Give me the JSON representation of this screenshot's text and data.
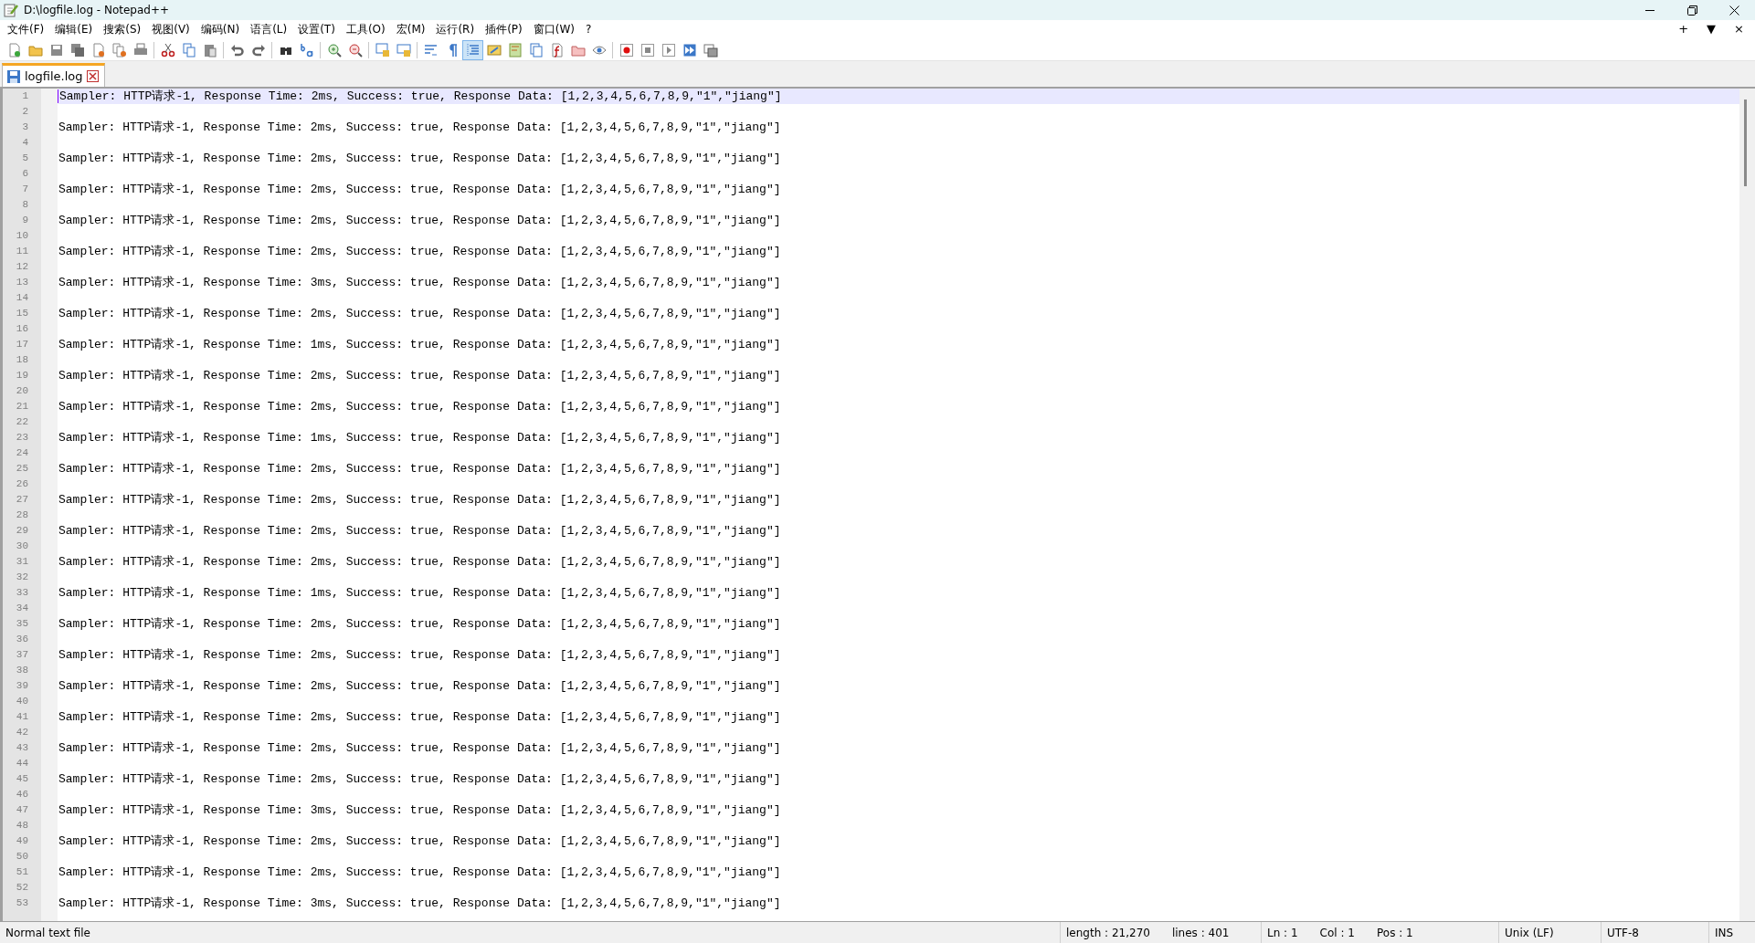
{
  "window": {
    "title": "D:\\logfile.log - Notepad++"
  },
  "menu": [
    "文件(F)",
    "编辑(E)",
    "搜索(S)",
    "视图(V)",
    "编码(N)",
    "语言(L)",
    "设置(T)",
    "工具(O)",
    "宏(M)",
    "运行(R)",
    "插件(P)",
    "窗口(W)",
    "?"
  ],
  "toolbar": [
    [
      {
        "kind": "new",
        "pressed": false
      },
      {
        "kind": "open",
        "pressed": false
      },
      {
        "kind": "save",
        "pressed": false
      },
      {
        "kind": "save_all",
        "pressed": false
      },
      {
        "kind": "close",
        "pressed": false
      },
      {
        "kind": "close_all",
        "pressed": false
      },
      {
        "kind": "print",
        "pressed": false
      }
    ],
    [
      {
        "kind": "cut",
        "pressed": false
      },
      {
        "kind": "copy",
        "pressed": false
      },
      {
        "kind": "paste",
        "pressed": false
      }
    ],
    [
      {
        "kind": "undo",
        "pressed": false
      },
      {
        "kind": "redo",
        "pressed": false
      }
    ],
    [
      {
        "kind": "find",
        "pressed": false
      },
      {
        "kind": "replace",
        "pressed": false
      }
    ],
    [
      {
        "kind": "zoom_in",
        "pressed": false
      },
      {
        "kind": "zoom_out",
        "pressed": false
      }
    ],
    [
      {
        "kind": "sync_v",
        "pressed": false
      },
      {
        "kind": "sync_h",
        "pressed": false
      }
    ],
    [
      {
        "kind": "wrap",
        "pressed": false
      },
      {
        "kind": "all_chars",
        "pressed": false
      },
      {
        "kind": "indent_guide",
        "pressed": true
      },
      {
        "kind": "udl",
        "pressed": false
      },
      {
        "kind": "doc_map",
        "pressed": false
      },
      {
        "kind": "doc_list",
        "pressed": false
      },
      {
        "kind": "function_list",
        "pressed": false
      },
      {
        "kind": "folder",
        "pressed": false
      },
      {
        "kind": "monitor",
        "pressed": false
      }
    ],
    [
      {
        "kind": "record",
        "pressed": false
      },
      {
        "kind": "stop",
        "pressed": false
      },
      {
        "kind": "play",
        "pressed": false
      },
      {
        "kind": "play_multi",
        "pressed": false
      },
      {
        "kind": "save_macro",
        "pressed": false
      }
    ]
  ],
  "tabs": [
    {
      "label": "logfile.log",
      "selected": true
    }
  ],
  "tab_bar_controls": [
    "+",
    "▼",
    "×"
  ],
  "editor": {
    "lines": [
      {
        "number": "1",
        "text": "Sampler: HTTP请求-1, Response Time: 2ms, Success: true, Response Data: [1,2,3,4,5,6,7,8,9,\"1\",\"jiang\"]",
        "current": true
      },
      {
        "number": "2",
        "current": false
      },
      {
        "number": "3",
        "text": "Sampler: HTTP请求-1, Response Time: 2ms, Success: true, Response Data: [1,2,3,4,5,6,7,8,9,\"1\",\"jiang\"]",
        "current": false
      },
      {
        "number": "4",
        "current": false
      },
      {
        "number": "5",
        "text": "Sampler: HTTP请求-1, Response Time: 2ms, Success: true, Response Data: [1,2,3,4,5,6,7,8,9,\"1\",\"jiang\"]",
        "current": false
      },
      {
        "number": "6",
        "current": false
      },
      {
        "number": "7",
        "text": "Sampler: HTTP请求-1, Response Time: 2ms, Success: true, Response Data: [1,2,3,4,5,6,7,8,9,\"1\",\"jiang\"]",
        "current": false
      },
      {
        "number": "8",
        "current": false
      },
      {
        "number": "9",
        "text": "Sampler: HTTP请求-1, Response Time: 2ms, Success: true, Response Data: [1,2,3,4,5,6,7,8,9,\"1\",\"jiang\"]",
        "current": false
      },
      {
        "number": "10",
        "current": false
      },
      {
        "number": "11",
        "text": "Sampler: HTTP请求-1, Response Time: 2ms, Success: true, Response Data: [1,2,3,4,5,6,7,8,9,\"1\",\"jiang\"]",
        "current": false
      },
      {
        "number": "12",
        "current": false
      },
      {
        "number": "13",
        "text": "Sampler: HTTP请求-1, Response Time: 3ms, Success: true, Response Data: [1,2,3,4,5,6,7,8,9,\"1\",\"jiang\"]",
        "current": false
      },
      {
        "number": "14",
        "current": false
      },
      {
        "number": "15",
        "text": "Sampler: HTTP请求-1, Response Time: 2ms, Success: true, Response Data: [1,2,3,4,5,6,7,8,9,\"1\",\"jiang\"]",
        "current": false
      },
      {
        "number": "16",
        "current": false
      },
      {
        "number": "17",
        "text": "Sampler: HTTP请求-1, Response Time: 1ms, Success: true, Response Data: [1,2,3,4,5,6,7,8,9,\"1\",\"jiang\"]",
        "current": false
      },
      {
        "number": "18",
        "current": false
      },
      {
        "number": "19",
        "text": "Sampler: HTTP请求-1, Response Time: 2ms, Success: true, Response Data: [1,2,3,4,5,6,7,8,9,\"1\",\"jiang\"]",
        "current": false
      },
      {
        "number": "20",
        "current": false
      },
      {
        "number": "21",
        "text": "Sampler: HTTP请求-1, Response Time: 2ms, Success: true, Response Data: [1,2,3,4,5,6,7,8,9,\"1\",\"jiang\"]",
        "current": false
      },
      {
        "number": "22",
        "current": false
      },
      {
        "number": "23",
        "text": "Sampler: HTTP请求-1, Response Time: 1ms, Success: true, Response Data: [1,2,3,4,5,6,7,8,9,\"1\",\"jiang\"]",
        "current": false
      },
      {
        "number": "24",
        "current": false
      },
      {
        "number": "25",
        "text": "Sampler: HTTP请求-1, Response Time: 2ms, Success: true, Response Data: [1,2,3,4,5,6,7,8,9,\"1\",\"jiang\"]",
        "current": false
      },
      {
        "number": "26",
        "current": false
      },
      {
        "number": "27",
        "text": "Sampler: HTTP请求-1, Response Time: 2ms, Success: true, Response Data: [1,2,3,4,5,6,7,8,9,\"1\",\"jiang\"]",
        "current": false
      },
      {
        "number": "28",
        "current": false
      },
      {
        "number": "29",
        "text": "Sampler: HTTP请求-1, Response Time: 2ms, Success: true, Response Data: [1,2,3,4,5,6,7,8,9,\"1\",\"jiang\"]",
        "current": false
      },
      {
        "number": "30",
        "current": false
      },
      {
        "number": "31",
        "text": "Sampler: HTTP请求-1, Response Time: 2ms, Success: true, Response Data: [1,2,3,4,5,6,7,8,9,\"1\",\"jiang\"]",
        "current": false
      },
      {
        "number": "32",
        "current": false
      },
      {
        "number": "33",
        "text": "Sampler: HTTP请求-1, Response Time: 1ms, Success: true, Response Data: [1,2,3,4,5,6,7,8,9,\"1\",\"jiang\"]",
        "current": false
      },
      {
        "number": "34",
        "current": false
      },
      {
        "number": "35",
        "text": "Sampler: HTTP请求-1, Response Time: 2ms, Success: true, Response Data: [1,2,3,4,5,6,7,8,9,\"1\",\"jiang\"]",
        "current": false
      },
      {
        "number": "36",
        "current": false
      },
      {
        "number": "37",
        "text": "Sampler: HTTP请求-1, Response Time: 2ms, Success: true, Response Data: [1,2,3,4,5,6,7,8,9,\"1\",\"jiang\"]",
        "current": false
      },
      {
        "number": "38",
        "current": false
      },
      {
        "number": "39",
        "text": "Sampler: HTTP请求-1, Response Time: 2ms, Success: true, Response Data: [1,2,3,4,5,6,7,8,9,\"1\",\"jiang\"]",
        "current": false
      },
      {
        "number": "40",
        "current": false
      },
      {
        "number": "41",
        "text": "Sampler: HTTP请求-1, Response Time: 2ms, Success: true, Response Data: [1,2,3,4,5,6,7,8,9,\"1\",\"jiang\"]",
        "current": false
      },
      {
        "number": "42",
        "current": false
      },
      {
        "number": "43",
        "text": "Sampler: HTTP请求-1, Response Time: 2ms, Success: true, Response Data: [1,2,3,4,5,6,7,8,9,\"1\",\"jiang\"]",
        "current": false
      },
      {
        "number": "44",
        "current": false
      },
      {
        "number": "45",
        "text": "Sampler: HTTP请求-1, Response Time: 2ms, Success: true, Response Data: [1,2,3,4,5,6,7,8,9,\"1\",\"jiang\"]",
        "current": false
      },
      {
        "number": "46",
        "current": false
      },
      {
        "number": "47",
        "text": "Sampler: HTTP请求-1, Response Time: 3ms, Success: true, Response Data: [1,2,3,4,5,6,7,8,9,\"1\",\"jiang\"]",
        "current": false
      },
      {
        "number": "48",
        "current": false
      },
      {
        "number": "49",
        "text": "Sampler: HTTP请求-1, Response Time: 2ms, Success: true, Response Data: [1,2,3,4,5,6,7,8,9,\"1\",\"jiang\"]",
        "current": false
      },
      {
        "number": "50",
        "current": false
      },
      {
        "number": "51",
        "text": "Sampler: HTTP请求-1, Response Time: 2ms, Success: true, Response Data: [1,2,3,4,5,6,7,8,9,\"1\",\"jiang\"]",
        "current": false
      },
      {
        "number": "52",
        "current": false
      },
      {
        "number": "53",
        "text": "Sampler: HTTP请求-1, Response Time: 3ms, Success: true, Response Data: [1,2,3,4,5,6,7,8,9,\"1\",\"jiang\"]",
        "current": false
      }
    ]
  },
  "status_bar": {
    "file_type": "Normal text file",
    "length": "length : 21,270",
    "lines": "lines : 401",
    "ln": "Ln : 1",
    "col": "Col : 1",
    "pos": "Pos : 1",
    "eol": "Unix (LF)",
    "encoding": "UTF-8",
    "mode": "INS"
  }
}
